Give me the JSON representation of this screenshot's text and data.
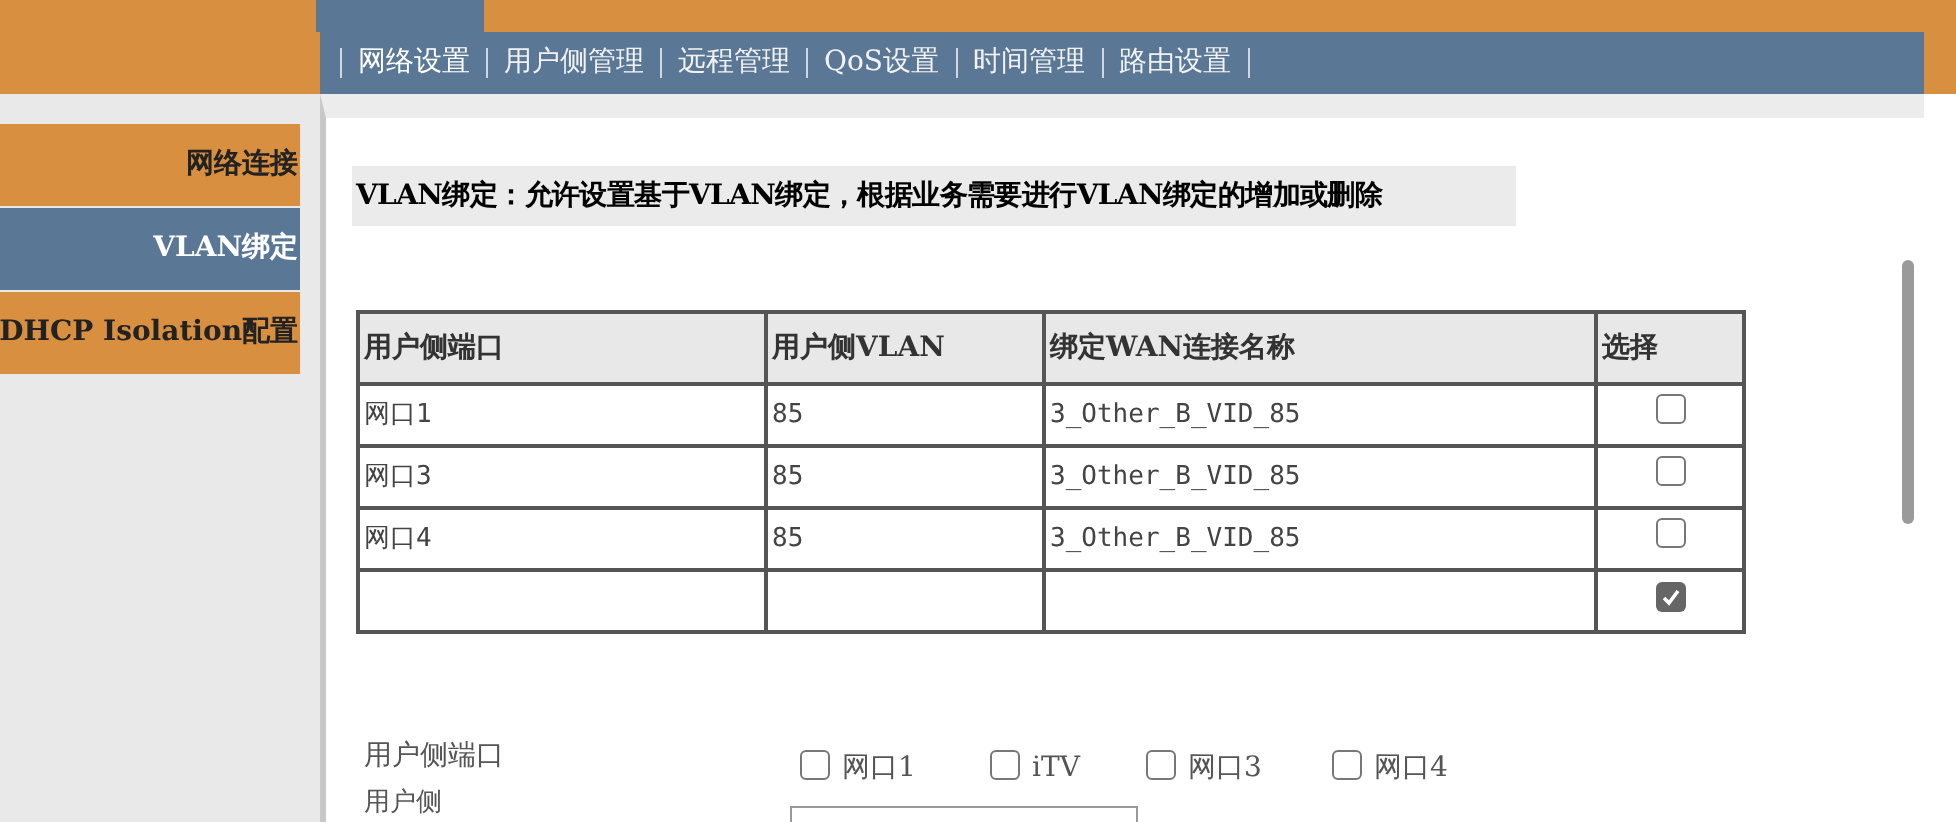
{
  "nav_tabs": [
    {
      "label": "网络设置",
      "selected": true
    },
    {
      "label": "用户侧管理",
      "selected": false
    },
    {
      "label": "远程管理",
      "selected": false
    },
    {
      "label": "QoS设置",
      "selected": false
    },
    {
      "label": "时间管理",
      "selected": false
    },
    {
      "label": "路由设置",
      "selected": false
    }
  ],
  "sidebar": {
    "items": [
      {
        "label": "网络连接",
        "selected": false
      },
      {
        "label": "VLAN绑定",
        "selected": true
      },
      {
        "label": "DHCP Isolation配置",
        "selected": false
      }
    ]
  },
  "description": "VLAN绑定：允许设置基于VLAN绑定，根据业务需要进行VLAN绑定的增加或删除",
  "table": {
    "columns": [
      "用户侧端口",
      "用户侧VLAN",
      "绑定WAN连接名称",
      "选择"
    ],
    "rows": [
      {
        "port": "网口1",
        "vlan": "85",
        "wan": "3_Other_B_VID_85",
        "checked": false
      },
      {
        "port": "网口3",
        "vlan": "85",
        "wan": "3_Other_B_VID_85",
        "checked": false
      },
      {
        "port": "网口4",
        "vlan": "85",
        "wan": "3_Other_B_VID_85",
        "checked": false
      },
      {
        "checked": true
      }
    ]
  },
  "form": {
    "port_label": "用户侧端口",
    "ports": [
      {
        "label": "网口1",
        "checked": false
      },
      {
        "label": "iTV",
        "checked": false
      },
      {
        "label": "网口3",
        "checked": false
      },
      {
        "label": "网口4",
        "checked": false
      }
    ],
    "next_label": "用户侧"
  }
}
